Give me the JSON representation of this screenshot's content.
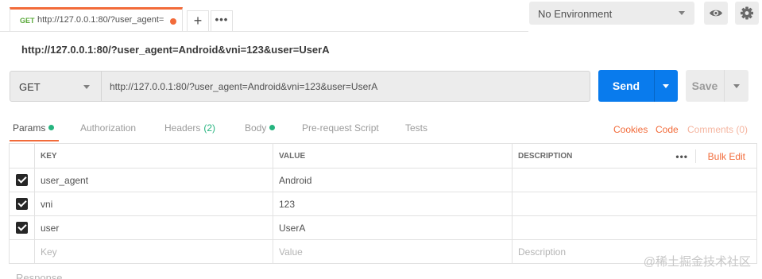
{
  "tab": {
    "method": "GET",
    "title": "http://127.0.0.1:80/?user_agent="
  },
  "environment": {
    "selected": "No Environment"
  },
  "request": {
    "heading": "http://127.0.0.1:80/?user_agent=Android&vni=123&user=UserA",
    "method": "GET",
    "url": "http://127.0.0.1:80/?user_agent=Android&vni=123&user=UserA",
    "send_label": "Send",
    "save_label": "Save"
  },
  "subtabs": {
    "params": "Params",
    "authorization": "Authorization",
    "headers": "Headers",
    "headers_count": "(2)",
    "body": "Body",
    "prerequest": "Pre-request Script",
    "tests": "Tests",
    "cookies": "Cookies",
    "code": "Code",
    "comments": "Comments (0)"
  },
  "params_table": {
    "columns": {
      "key": "KEY",
      "value": "VALUE",
      "description": "DESCRIPTION"
    },
    "bulk_edit": "Bulk Edit",
    "rows": [
      {
        "key": "user_agent",
        "value": "Android",
        "description": ""
      },
      {
        "key": "vni",
        "value": "123",
        "description": ""
      },
      {
        "key": "user",
        "value": "UserA",
        "description": ""
      }
    ],
    "placeholder": {
      "key": "Key",
      "value": "Value",
      "description": "Description"
    }
  },
  "response_label": "Response",
  "watermark": "@稀土掘金技术社区",
  "colors": {
    "accent": "#f26b3a",
    "send": "#097bed",
    "get_method": "#59a839",
    "active_dot": "#26b47f"
  }
}
